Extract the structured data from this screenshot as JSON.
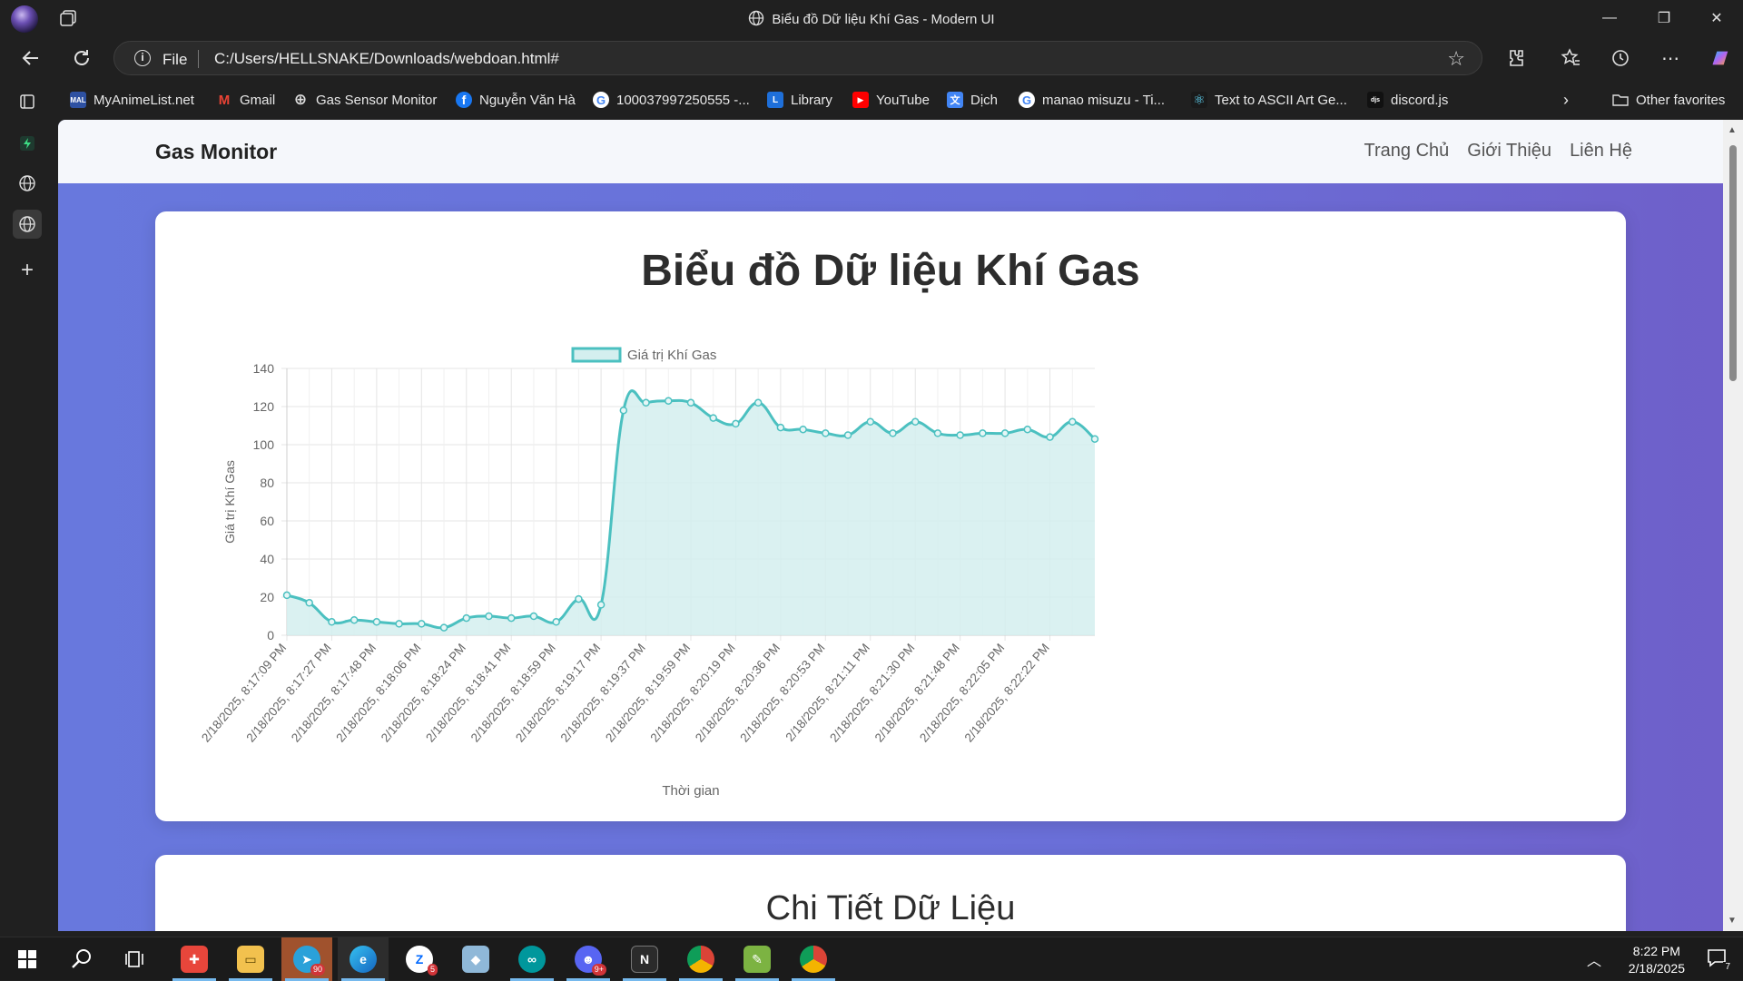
{
  "window": {
    "title": "Biểu đồ Dữ liệu Khí Gas - Modern UI",
    "controls": {
      "minimize": "—",
      "restore": "❐",
      "close": "✕"
    }
  },
  "address_bar": {
    "scheme": "File",
    "url": "C:/Users/HELLSNAKE/Downloads/webdoan.html#"
  },
  "favorites": [
    {
      "label": "MyAnimeList.net",
      "icon": "mal-icon",
      "color": "#2e51a2",
      "glyph": "MAL"
    },
    {
      "label": "Gmail",
      "icon": "gmail-icon",
      "color": "#ea4335",
      "glyph": "M"
    },
    {
      "label": "Gas Sensor Monitor",
      "icon": "globe-icon",
      "color": "#444444",
      "glyph": "⊕"
    },
    {
      "label": "Nguyễn Văn Hà",
      "icon": "facebook-icon",
      "color": "#1877f2",
      "glyph": "f"
    },
    {
      "label": "100037997250555 -...",
      "icon": "google-icon",
      "color": "#ffffff",
      "glyph": "G"
    },
    {
      "label": "Library",
      "icon": "library-icon",
      "color": "#1e6fd9",
      "glyph": "L"
    },
    {
      "label": "YouTube",
      "icon": "youtube-icon",
      "color": "#ff0000",
      "glyph": "▶"
    },
    {
      "label": "Dịch",
      "icon": "translate-icon",
      "color": "#4285f4",
      "glyph": "文"
    },
    {
      "label": "manao misuzu - Ti...",
      "icon": "google-icon",
      "color": "#ffffff",
      "glyph": "G"
    },
    {
      "label": "Text to ASCII Art Ge...",
      "icon": "react-icon",
      "color": "#1a1a1a",
      "glyph": "⚛"
    },
    {
      "label": "discord.js",
      "icon": "discordjs-icon",
      "color": "#111111",
      "glyph": "djs"
    }
  ],
  "other_favorites": "Other favorites",
  "site": {
    "brand": "Gas Monitor",
    "nav": [
      "Trang Chủ",
      "Giới Thiệu",
      "Liên Hệ"
    ],
    "chart_heading": "Biểu đồ Dữ liệu Khí Gas",
    "detail_heading": "Chi Tiết Dữ Liệu"
  },
  "chart_data": {
    "type": "line",
    "legend": "Giá trị Khí Gas",
    "xlabel": "Thời gian",
    "ylabel": "Giá trị Khí Gas",
    "ylim": [
      0,
      140
    ],
    "yticks": [
      0,
      20,
      40,
      60,
      80,
      100,
      120,
      140
    ],
    "grid": true,
    "fill": true,
    "color": "#4bc0c0",
    "fill_color": "#d4efef",
    "tick_labels": [
      "2/18/2025, 8:17:09 PM",
      "2/18/2025, 8:17:27 PM",
      "2/18/2025, 8:17:48 PM",
      "2/18/2025, 8:18:06 PM",
      "2/18/2025, 8:18:24 PM",
      "2/18/2025, 8:18:41 PM",
      "2/18/2025, 8:18:59 PM",
      "2/18/2025, 8:19:17 PM",
      "2/18/2025, 8:19:37 PM",
      "2/18/2025, 8:19:59 PM",
      "2/18/2025, 8:20:19 PM",
      "2/18/2025, 8:20:36 PM",
      "2/18/2025, 8:20:53 PM",
      "2/18/2025, 8:21:11 PM",
      "2/18/2025, 8:21:30 PM",
      "2/18/2025, 8:21:48 PM",
      "2/18/2025, 8:22:05 PM",
      "2/18/2025, 8:22:22 PM"
    ],
    "values": [
      21,
      17,
      7,
      8,
      7,
      6,
      6,
      4,
      9,
      10,
      9,
      10,
      7,
      19,
      16,
      118,
      122,
      123,
      122,
      114,
      111,
      122,
      109,
      108,
      106,
      105,
      112,
      106,
      112,
      106,
      105,
      106,
      106,
      108,
      104,
      112,
      103
    ]
  },
  "taskbar": {
    "apps": [
      {
        "name": "start-icon",
        "color": "transparent",
        "glyph": "⊞"
      },
      {
        "name": "search-icon",
        "color": "transparent",
        "glyph": "⌕"
      },
      {
        "name": "task-view-icon",
        "color": "transparent",
        "glyph": "▯"
      },
      {
        "name": "game-controller-icon",
        "color": "#e8463b",
        "glyph": "🎮"
      },
      {
        "name": "file-explorer-icon",
        "color": "#f2c14e",
        "glyph": "▭"
      },
      {
        "name": "telegram-icon",
        "color": "#2aa1d9",
        "glyph": "➤",
        "badge": "90"
      },
      {
        "name": "edge-icon",
        "color": "#1f8fd6",
        "glyph": "e"
      },
      {
        "name": "zalo-icon",
        "color": "#ffffff",
        "glyph": "Z",
        "badge": "5"
      },
      {
        "name": "notes-app-icon",
        "color": "#8fb8d8",
        "glyph": "◆"
      },
      {
        "name": "arduino-icon",
        "color": "#00979c",
        "glyph": "∞"
      },
      {
        "name": "discord-icon",
        "color": "#5865f2",
        "glyph": "☻",
        "badge": "9+"
      },
      {
        "name": "notion-icon",
        "color": "#2b2b2b",
        "glyph": "N"
      },
      {
        "name": "chrome-profile-icon",
        "color": "#dd4b39",
        "glyph": "◉"
      },
      {
        "name": "notepad-plus-icon",
        "color": "#7cb342",
        "glyph": "✎"
      },
      {
        "name": "chrome-icon",
        "color": "#db4437",
        "glyph": "◉"
      }
    ],
    "time": "8:22 PM",
    "date": "2/18/2025",
    "notification_count": "7"
  }
}
